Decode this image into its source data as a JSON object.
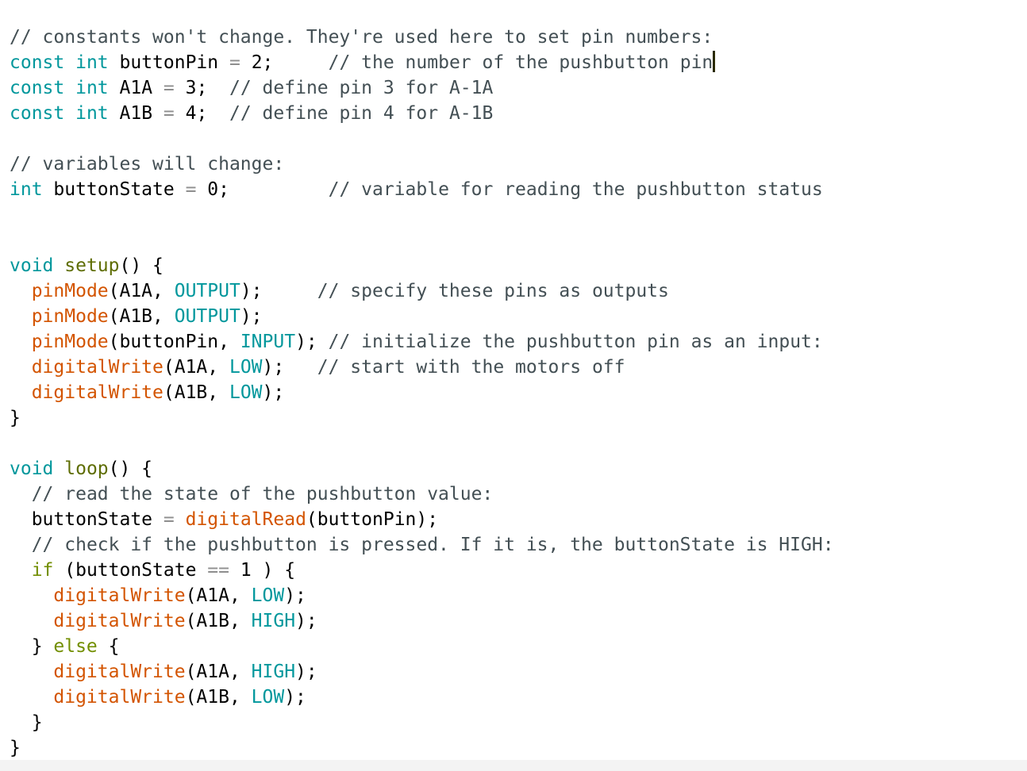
{
  "editor": {
    "colors": {
      "comment": "#434f54",
      "keyword": "#00979c",
      "control": "#728e00",
      "function": "#d35400",
      "constant": "#00979c",
      "plain": "#000000",
      "caret": "#2a2a00"
    },
    "caret_line_index": 1,
    "lines": [
      [
        {
          "t": "comment",
          "v": "// constants won't change. They're used here to set pin numbers:"
        }
      ],
      [
        {
          "t": "keyword",
          "v": "const"
        },
        {
          "t": "plain",
          "v": " "
        },
        {
          "t": "keyword",
          "v": "int"
        },
        {
          "t": "plain",
          "v": " buttonPin "
        },
        {
          "t": "operator",
          "v": "="
        },
        {
          "t": "plain",
          "v": " 2;     "
        },
        {
          "t": "comment",
          "v": "// the number of the pushbutton pin"
        }
      ],
      [
        {
          "t": "keyword",
          "v": "const"
        },
        {
          "t": "plain",
          "v": " "
        },
        {
          "t": "keyword",
          "v": "int"
        },
        {
          "t": "plain",
          "v": " A1A "
        },
        {
          "t": "operator",
          "v": "="
        },
        {
          "t": "plain",
          "v": " 3;  "
        },
        {
          "t": "comment",
          "v": "// define pin 3 for A-1A"
        }
      ],
      [
        {
          "t": "keyword",
          "v": "const"
        },
        {
          "t": "plain",
          "v": " "
        },
        {
          "t": "keyword",
          "v": "int"
        },
        {
          "t": "plain",
          "v": " A1B "
        },
        {
          "t": "operator",
          "v": "="
        },
        {
          "t": "plain",
          "v": " 4;  "
        },
        {
          "t": "comment",
          "v": "// define pin 4 for A-1B"
        }
      ],
      [],
      [
        {
          "t": "comment",
          "v": "// variables will change:"
        }
      ],
      [
        {
          "t": "keyword",
          "v": "int"
        },
        {
          "t": "plain",
          "v": " buttonState "
        },
        {
          "t": "operator",
          "v": "="
        },
        {
          "t": "plain",
          "v": " 0;         "
        },
        {
          "t": "comment",
          "v": "// variable for reading the pushbutton status"
        }
      ],
      [],
      [],
      [
        {
          "t": "keyword",
          "v": "void"
        },
        {
          "t": "plain",
          "v": " "
        },
        {
          "t": "setupname",
          "v": "setup"
        },
        {
          "t": "plain",
          "v": "() {"
        }
      ],
      [
        {
          "t": "plain",
          "v": "  "
        },
        {
          "t": "function",
          "v": "pinMode"
        },
        {
          "t": "plain",
          "v": "(A1A, "
        },
        {
          "t": "constant",
          "v": "OUTPUT"
        },
        {
          "t": "plain",
          "v": ");     "
        },
        {
          "t": "comment",
          "v": "// specify these pins as outputs"
        }
      ],
      [
        {
          "t": "plain",
          "v": "  "
        },
        {
          "t": "function",
          "v": "pinMode"
        },
        {
          "t": "plain",
          "v": "(A1B, "
        },
        {
          "t": "constant",
          "v": "OUTPUT"
        },
        {
          "t": "plain",
          "v": ");"
        }
      ],
      [
        {
          "t": "plain",
          "v": "  "
        },
        {
          "t": "function",
          "v": "pinMode"
        },
        {
          "t": "plain",
          "v": "(buttonPin, "
        },
        {
          "t": "constant",
          "v": "INPUT"
        },
        {
          "t": "plain",
          "v": "); "
        },
        {
          "t": "comment",
          "v": "// initialize the pushbutton pin as an input:"
        }
      ],
      [
        {
          "t": "plain",
          "v": "  "
        },
        {
          "t": "function",
          "v": "digitalWrite"
        },
        {
          "t": "plain",
          "v": "(A1A, "
        },
        {
          "t": "constant",
          "v": "LOW"
        },
        {
          "t": "plain",
          "v": ");   "
        },
        {
          "t": "comment",
          "v": "// start with the motors off"
        }
      ],
      [
        {
          "t": "plain",
          "v": "  "
        },
        {
          "t": "function",
          "v": "digitalWrite"
        },
        {
          "t": "plain",
          "v": "(A1B, "
        },
        {
          "t": "constant",
          "v": "LOW"
        },
        {
          "t": "plain",
          "v": ");"
        }
      ],
      [
        {
          "t": "plain",
          "v": "}"
        }
      ],
      [],
      [
        {
          "t": "keyword",
          "v": "void"
        },
        {
          "t": "plain",
          "v": " "
        },
        {
          "t": "setupname",
          "v": "loop"
        },
        {
          "t": "plain",
          "v": "() {"
        }
      ],
      [
        {
          "t": "plain",
          "v": "  "
        },
        {
          "t": "comment",
          "v": "// read the state of the pushbutton value:"
        }
      ],
      [
        {
          "t": "plain",
          "v": "  buttonState "
        },
        {
          "t": "operator",
          "v": "="
        },
        {
          "t": "plain",
          "v": " "
        },
        {
          "t": "function",
          "v": "digitalRead"
        },
        {
          "t": "plain",
          "v": "(buttonPin);"
        }
      ],
      [
        {
          "t": "plain",
          "v": "  "
        },
        {
          "t": "comment",
          "v": "// check if the pushbutton is pressed. If it is, the buttonState is HIGH:"
        }
      ],
      [
        {
          "t": "plain",
          "v": "  "
        },
        {
          "t": "control",
          "v": "if"
        },
        {
          "t": "plain",
          "v": " (buttonState "
        },
        {
          "t": "operator",
          "v": "=="
        },
        {
          "t": "plain",
          "v": " 1 ) {"
        }
      ],
      [
        {
          "t": "plain",
          "v": "    "
        },
        {
          "t": "function",
          "v": "digitalWrite"
        },
        {
          "t": "plain",
          "v": "(A1A, "
        },
        {
          "t": "constant",
          "v": "LOW"
        },
        {
          "t": "plain",
          "v": ");"
        }
      ],
      [
        {
          "t": "plain",
          "v": "    "
        },
        {
          "t": "function",
          "v": "digitalWrite"
        },
        {
          "t": "plain",
          "v": "(A1B, "
        },
        {
          "t": "constant",
          "v": "HIGH"
        },
        {
          "t": "plain",
          "v": ");"
        }
      ],
      [
        {
          "t": "plain",
          "v": "  } "
        },
        {
          "t": "control",
          "v": "else"
        },
        {
          "t": "plain",
          "v": " {"
        }
      ],
      [
        {
          "t": "plain",
          "v": "    "
        },
        {
          "t": "function",
          "v": "digitalWrite"
        },
        {
          "t": "plain",
          "v": "(A1A, "
        },
        {
          "t": "constant",
          "v": "HIGH"
        },
        {
          "t": "plain",
          "v": ");"
        }
      ],
      [
        {
          "t": "plain",
          "v": "    "
        },
        {
          "t": "function",
          "v": "digitalWrite"
        },
        {
          "t": "plain",
          "v": "(A1B, "
        },
        {
          "t": "constant",
          "v": "LOW"
        },
        {
          "t": "plain",
          "v": ");"
        }
      ],
      [
        {
          "t": "plain",
          "v": "  }"
        }
      ],
      [
        {
          "t": "plain",
          "v": "}"
        }
      ]
    ]
  }
}
